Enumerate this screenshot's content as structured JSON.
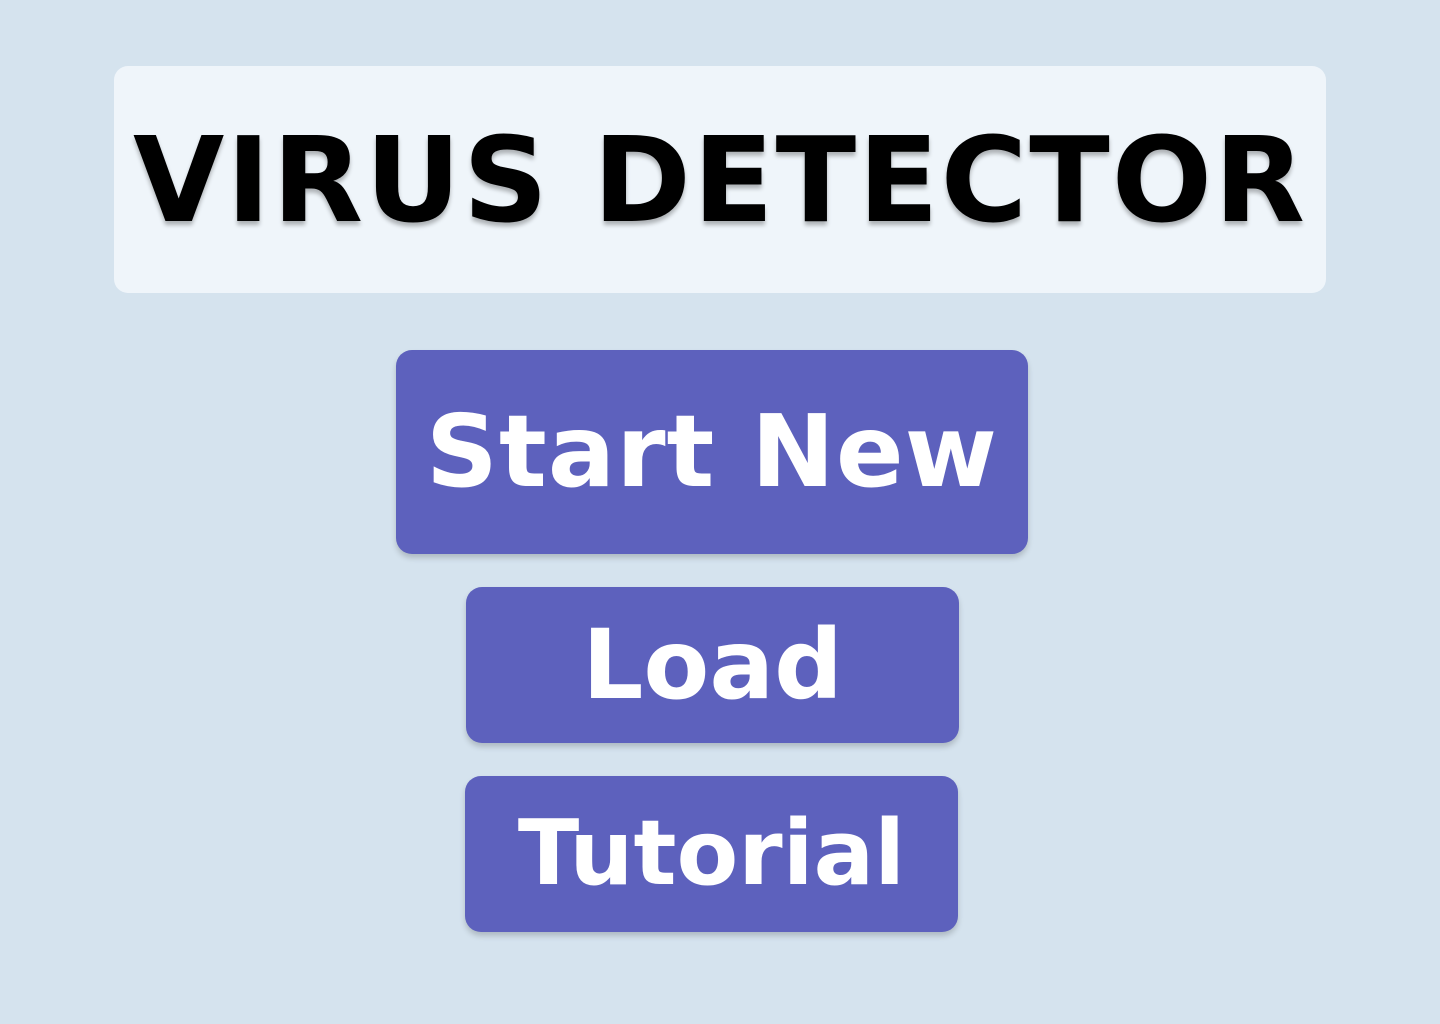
{
  "title": {
    "text": "VIRUS DETECTOR"
  },
  "menu": {
    "start_new_label": "Start New",
    "load_label": "Load",
    "tutorial_label": "Tutorial"
  },
  "colors": {
    "background": "#d5e3ee",
    "title_panel": "#eff5fa",
    "button": "#5d61bd",
    "button_text": "#ffffff",
    "title_text": "#000000"
  }
}
